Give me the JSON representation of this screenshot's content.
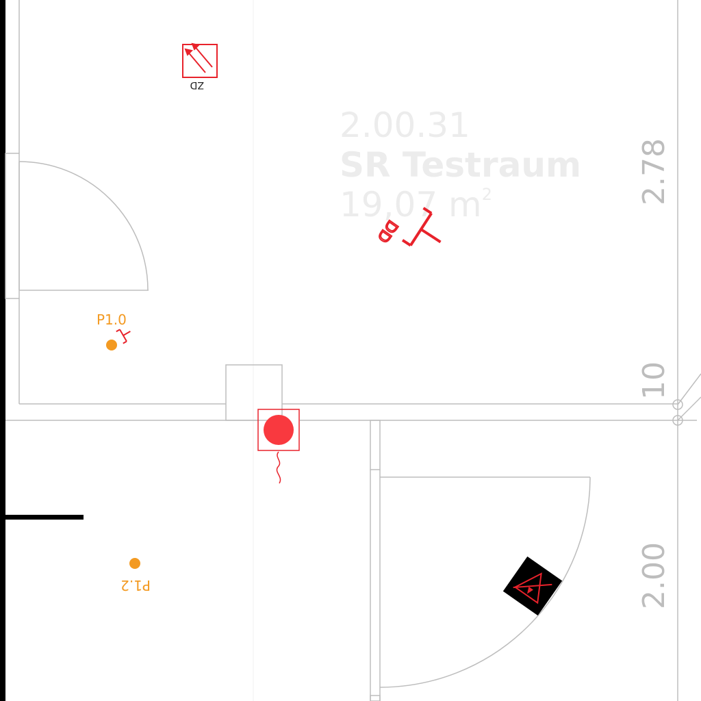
{
  "room": {
    "number": "2.00.31",
    "name": "SR Testraum",
    "area_value": "19,07 m",
    "area_unit_sup": "2"
  },
  "dimensions": {
    "height_upper": "2.78",
    "height_small": "10",
    "height_lower": "2.00"
  },
  "points": {
    "p1_0": "P1.0",
    "p1_2": "P1.2"
  },
  "symbols": {
    "zd_label": "ZD",
    "dd_label": "DD"
  },
  "colors": {
    "wall": "#bdbdbd",
    "safety_red": "#e8222b",
    "point_orange": "#f39a22",
    "wall_black": "#000000"
  },
  "icons": {
    "zd": "smoke-vent-arrows-icon",
    "dd": "ceiling-detector-icon",
    "alarm": "alarm-bell-icon",
    "warning": "electrical-hazard-sign-icon"
  }
}
